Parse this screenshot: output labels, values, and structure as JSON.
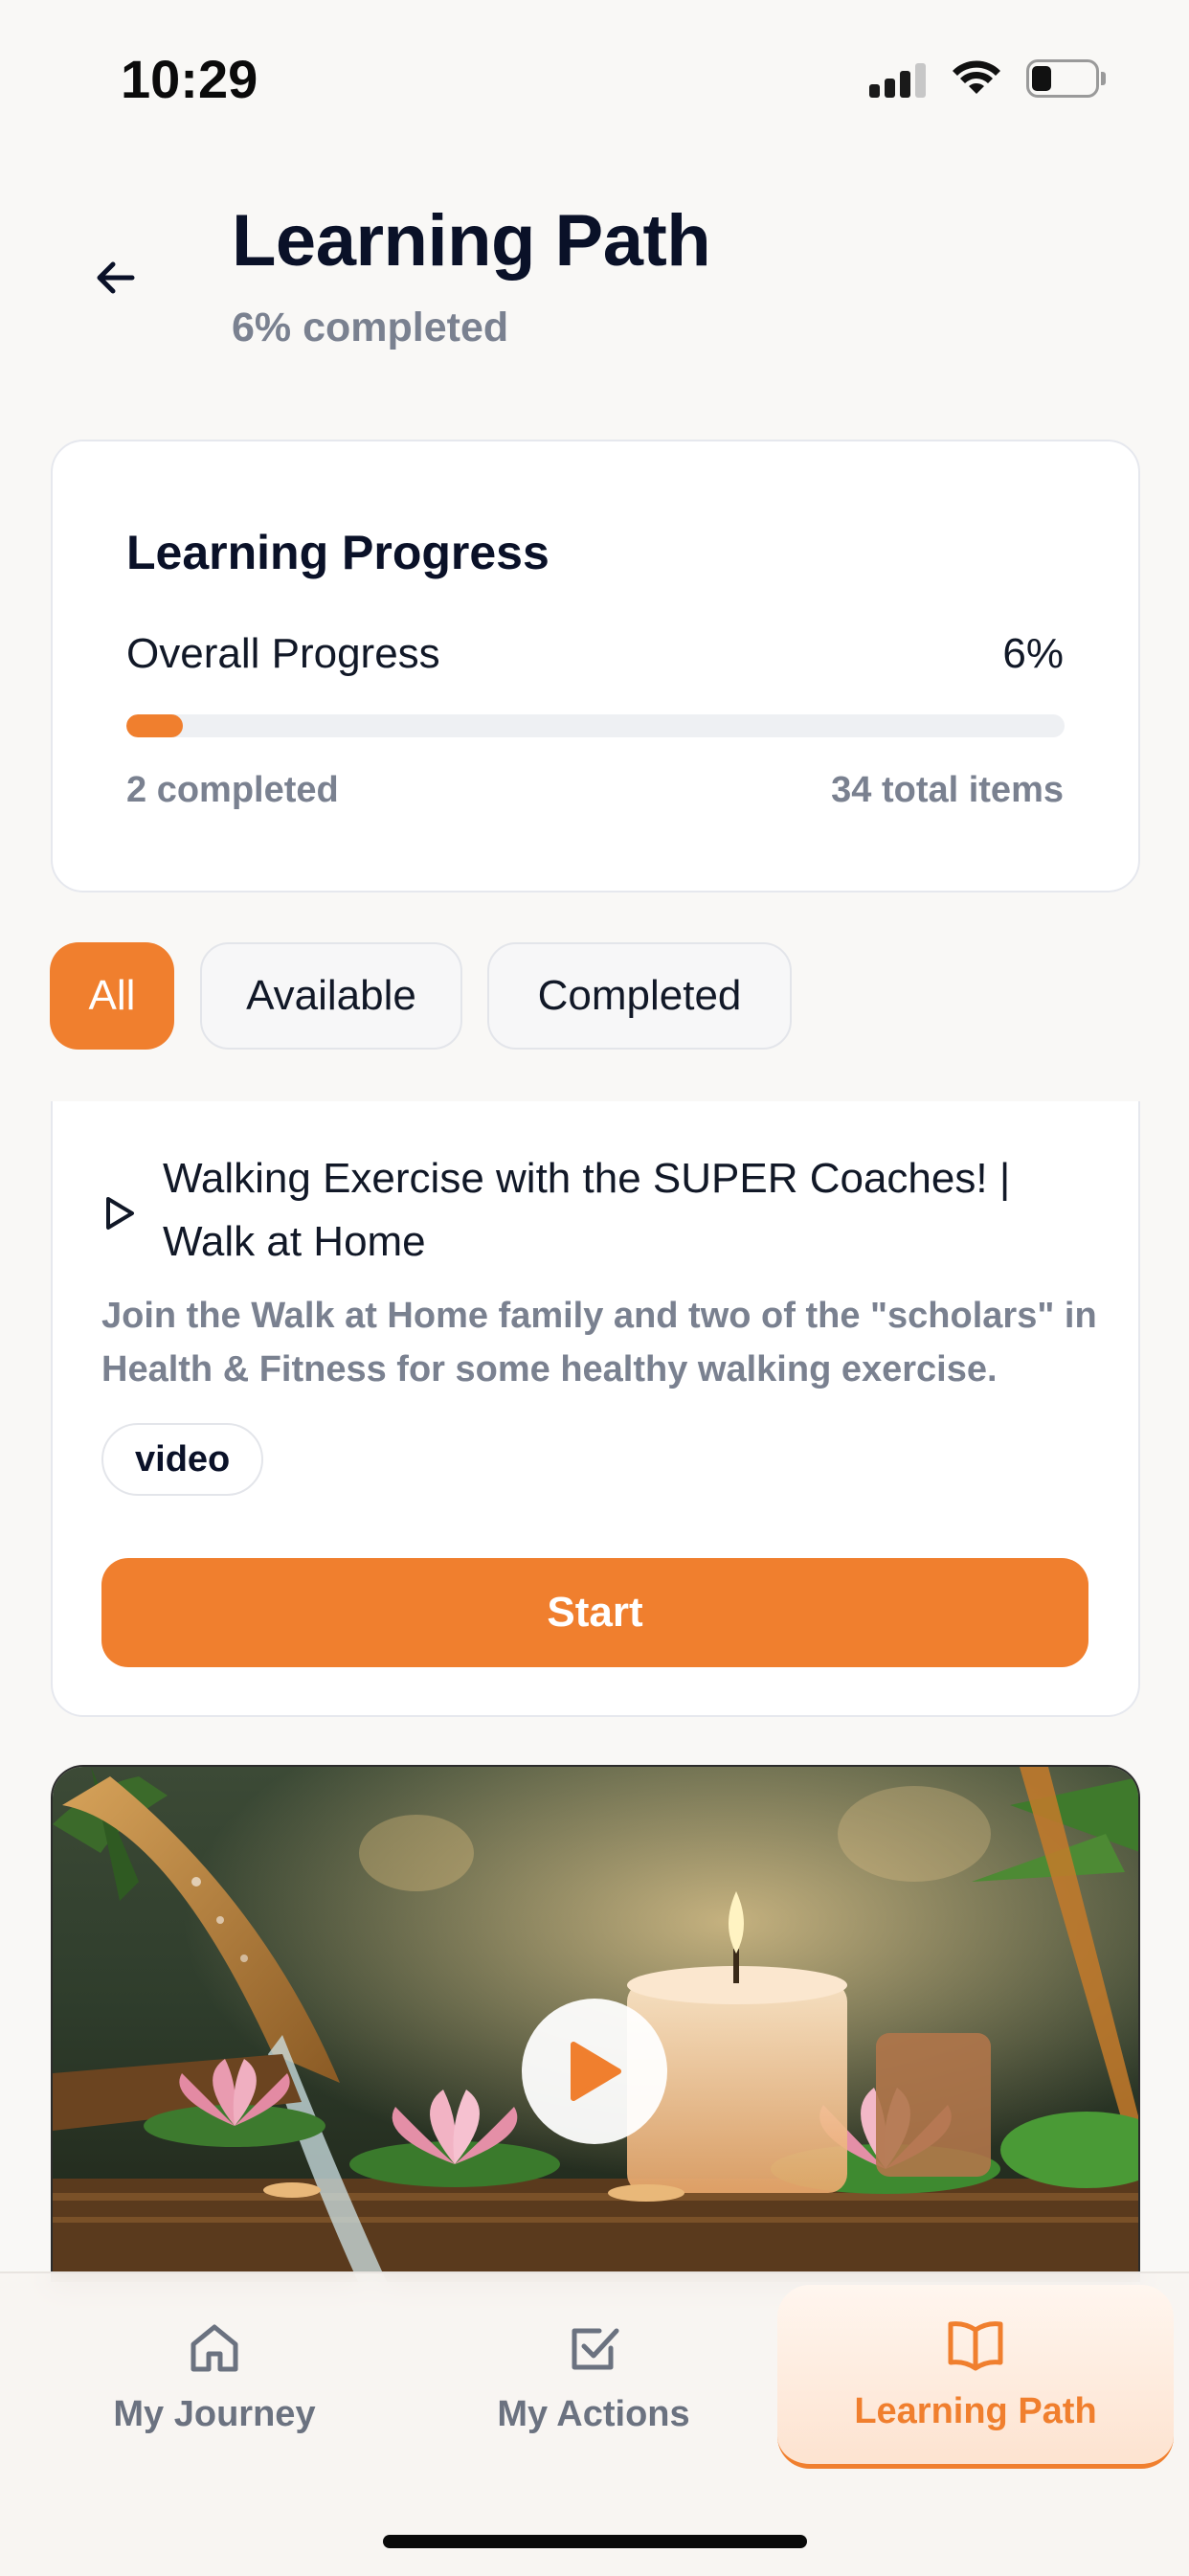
{
  "status_bar": {
    "time": "10:29"
  },
  "header": {
    "title": "Learning Path",
    "subtitle": "6% completed"
  },
  "progress_card": {
    "heading": "Learning Progress",
    "overall_label": "Overall Progress",
    "overall_percent_text": "6%",
    "progress_fraction": 0.06,
    "completed_text": "2 completed",
    "total_text": "34 total items"
  },
  "filters": {
    "tabs": [
      {
        "label": "All",
        "selected": true
      },
      {
        "label": "Available",
        "selected": false
      },
      {
        "label": "Completed",
        "selected": false
      }
    ]
  },
  "item": {
    "title": "Walking Exercise with the SUPER Coaches! | Walk at Home",
    "description": "Join the Walk at Home family and two of the \"scholars\" in Health & Fitness for some healthy walking exercise.",
    "badge": "video",
    "start_label": "Start",
    "icon": "play-outline-icon"
  },
  "media": {
    "icon": "play-icon"
  },
  "bottom_nav": {
    "items": [
      {
        "label": "My Journey",
        "icon": "home-icon"
      },
      {
        "label": "My Actions",
        "icon": "checkbox-icon"
      },
      {
        "label": "Learning Path",
        "icon": "book-open-icon",
        "active": true
      }
    ]
  },
  "colors": {
    "accent": "#f07f2e",
    "muted": "#7a8190",
    "title": "#0a1128"
  }
}
